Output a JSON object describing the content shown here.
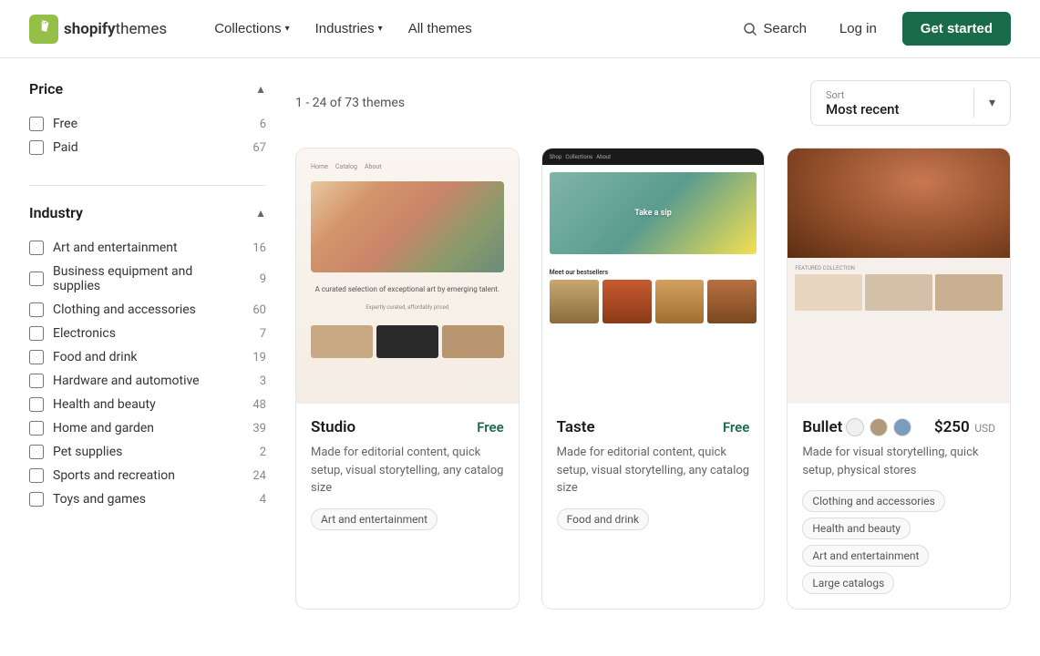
{
  "header": {
    "logo_text_bold": "shopify",
    "logo_text_regular": "themes",
    "nav": [
      {
        "label": "Collections",
        "has_dropdown": true
      },
      {
        "label": "Industries",
        "has_dropdown": true
      },
      {
        "label": "All themes",
        "has_dropdown": false
      }
    ],
    "search_label": "Search",
    "login_label": "Log in",
    "get_started_label": "Get started"
  },
  "sidebar": {
    "price_section": {
      "title": "Price",
      "items": [
        {
          "label": "Free",
          "count": 6
        },
        {
          "label": "Paid",
          "count": 67
        }
      ]
    },
    "industry_section": {
      "title": "Industry",
      "items": [
        {
          "label": "Art and entertainment",
          "count": 16
        },
        {
          "label": "Business equipment and supplies",
          "count": 9
        },
        {
          "label": "Clothing and accessories",
          "count": 60
        },
        {
          "label": "Electronics",
          "count": 7
        },
        {
          "label": "Food and drink",
          "count": 19
        },
        {
          "label": "Hardware and automotive",
          "count": 3
        },
        {
          "label": "Health and beauty",
          "count": 48
        },
        {
          "label": "Home and garden",
          "count": 39
        },
        {
          "label": "Pet supplies",
          "count": 2
        },
        {
          "label": "Sports and recreation",
          "count": 24
        },
        {
          "label": "Toys and games",
          "count": 4
        }
      ]
    }
  },
  "content": {
    "results_count": "1 - 24 of 73 themes",
    "sort": {
      "label": "Sort",
      "value": "Most recent"
    },
    "themes": [
      {
        "name": "Studio",
        "price_type": "free",
        "price_label": "Free",
        "description": "Made for editorial content, quick setup, visual storytelling, any catalog size",
        "tags": [
          "Art and entertainment"
        ],
        "swatches": []
      },
      {
        "name": "Taste",
        "price_type": "free",
        "price_label": "Free",
        "description": "Made for editorial content, quick setup, visual storytelling, any catalog size",
        "tags": [
          "Food and drink"
        ],
        "swatches": []
      },
      {
        "name": "Bullet",
        "price_type": "paid",
        "price_amount": "$250",
        "price_currency": "USD",
        "description": "Made for visual storytelling, quick setup, physical stores",
        "tags": [
          "Clothing and accessories",
          "Health and beauty",
          "Art and entertainment",
          "Large catalogs"
        ],
        "swatches": [
          "#f0f0f0",
          "#b09a7a",
          "#7b9cbf"
        ]
      }
    ]
  }
}
